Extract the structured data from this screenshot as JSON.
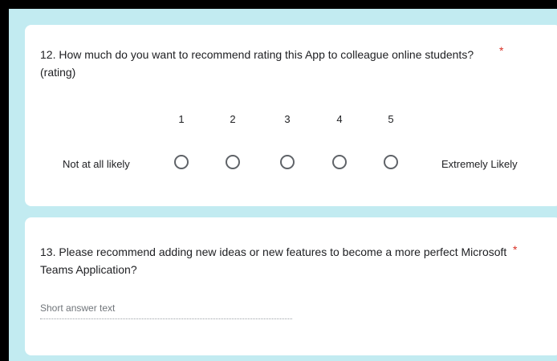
{
  "questions": [
    {
      "title": "12. How much do you want to recommend rating this App to colleague online students? (rating)",
      "required_mark": "*",
      "scale": [
        "1",
        "2",
        "3",
        "4",
        "5"
      ],
      "low_label": "Not at all likely",
      "high_label": "Extremely Likely"
    },
    {
      "title": "13. Please recommend adding new ideas or new features to become a more perfect Microsoft Teams Application?",
      "required_mark": "*",
      "placeholder": "Short answer text"
    }
  ],
  "colors": {
    "background": "#c2ebf1",
    "required": "#d93025",
    "radio_border": "#5f6368"
  }
}
